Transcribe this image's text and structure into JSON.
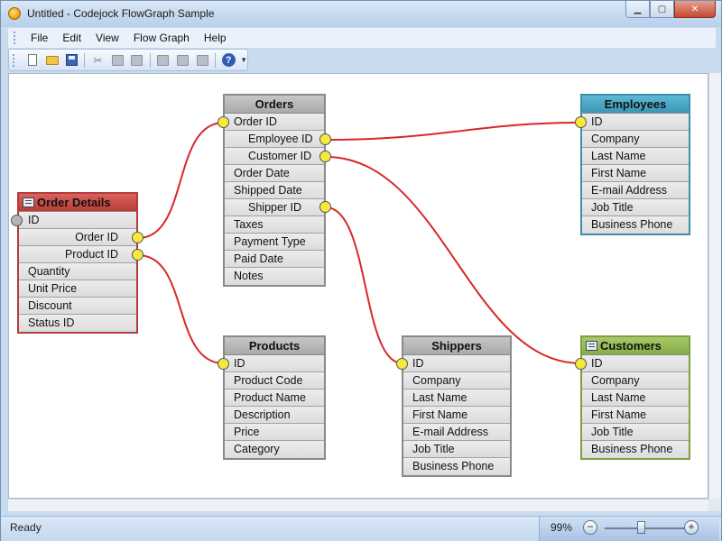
{
  "window": {
    "title": "Untitled - Codejock FlowGraph Sample"
  },
  "menu": [
    "File",
    "Edit",
    "View",
    "Flow Graph",
    "Help"
  ],
  "toolbar": {
    "buttons": [
      "new-icon",
      "open-icon",
      "save-icon",
      "cut-icon",
      "copy-icon",
      "paste-icon",
      "print-icon",
      "print-preview-icon",
      "find-icon",
      "help-icon"
    ]
  },
  "tables": {
    "order_details": {
      "title": "Order Details",
      "rows": [
        "ID",
        "Order ID",
        "Product ID",
        "Quantity",
        "Unit Price",
        "Discount",
        "Status ID"
      ]
    },
    "orders": {
      "title": "Orders",
      "rows": [
        "Order ID",
        "Employee ID",
        "Customer ID",
        "Order Date",
        "Shipped Date",
        "Shipper ID",
        "Taxes",
        "Payment Type",
        "Paid Date",
        "Notes"
      ]
    },
    "employees": {
      "title": "Employees",
      "rows": [
        "ID",
        "Company",
        "Last Name",
        "First Name",
        "E-mail Address",
        "Job Title",
        "Business Phone"
      ]
    },
    "products": {
      "title": "Products",
      "rows": [
        "ID",
        "Product Code",
        "Product Name",
        "Description",
        "Price",
        "Category"
      ]
    },
    "shippers": {
      "title": "Shippers",
      "rows": [
        "ID",
        "Company",
        "Last Name",
        "First Name",
        "E-mail Address",
        "Job Title",
        "Business Phone"
      ]
    },
    "customers": {
      "title": "Customers",
      "rows": [
        "ID",
        "Company",
        "Last Name",
        "First Name",
        "Job Title",
        "Business Phone"
      ]
    }
  },
  "connections": [
    {
      "from": "Order Details.Order ID",
      "to": "Orders.Order ID"
    },
    {
      "from": "Order Details.Product ID",
      "to": "Products.ID"
    },
    {
      "from": "Orders.Employee ID",
      "to": "Employees.ID"
    },
    {
      "from": "Orders.Customer ID",
      "to": "Customers.ID"
    },
    {
      "from": "Orders.Shipper ID",
      "to": "Shippers.ID"
    }
  ],
  "colors": {
    "connector": "#d8282a",
    "port": "#f5ea3a",
    "employees_header": "#3a97b6",
    "customers_header": "#87ad45",
    "order_details_header": "#b93b36",
    "default_header": "#a9a9a9"
  },
  "status": {
    "text": "Ready",
    "zoom": "99%",
    "zoom_out": "−",
    "zoom_in": "+"
  }
}
